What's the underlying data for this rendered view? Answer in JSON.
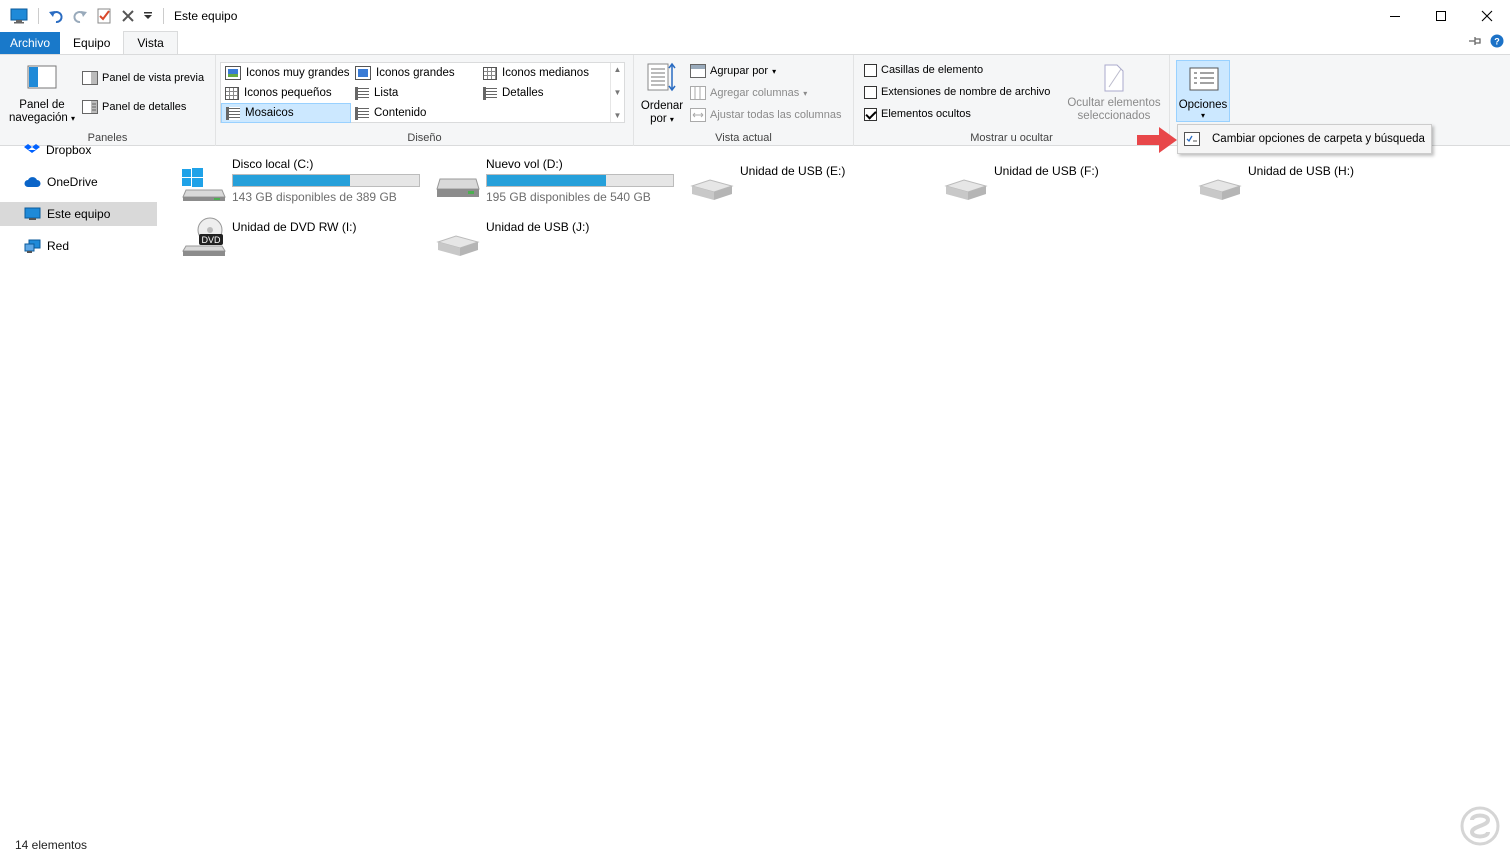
{
  "window": {
    "title": "Este equipo"
  },
  "tabs": {
    "file": "Archivo",
    "computer": "Equipo",
    "view": "Vista"
  },
  "ribbon": {
    "panes": {
      "nav_pane_line1": "Panel de",
      "nav_pane_line2": "navegación",
      "preview_pane": "Panel de vista previa",
      "details_pane": "Panel de detalles",
      "label": "Paneles"
    },
    "layout": {
      "extra_large": "Iconos muy grandes",
      "large": "Iconos grandes",
      "medium": "Iconos medianos",
      "small": "Iconos pequeños",
      "list": "Lista",
      "details": "Detalles",
      "tiles": "Mosaicos",
      "content": "Contenido",
      "label": "Diseño"
    },
    "current_view": {
      "sort_line1": "Ordenar",
      "sort_line2": "por",
      "group_by": "Agrupar por",
      "add_columns": "Agregar columnas",
      "size_columns": "Ajustar todas las columnas",
      "label": "Vista actual"
    },
    "show_hide": {
      "item_checkboxes": "Casillas de elemento",
      "file_extensions": "Extensiones de nombre de archivo",
      "hidden_items": "Elementos ocultos",
      "hide_selected_line1": "Ocultar elementos",
      "hide_selected_line2": "seleccionados",
      "label": "Mostrar u ocultar",
      "item_checkboxes_checked": false,
      "file_extensions_checked": false,
      "hidden_items_checked": true
    },
    "options": {
      "label": "Opciones"
    }
  },
  "menu": {
    "change_options": "Cambiar opciones de carpeta y búsqueda"
  },
  "nav": {
    "items": [
      {
        "label": "Dropbox",
        "icon": "dropbox-icon"
      },
      {
        "label": "OneDrive",
        "icon": "onedrive-icon"
      },
      {
        "label": "Este equipo",
        "icon": "computer-icon"
      },
      {
        "label": "Red",
        "icon": "network-icon"
      }
    ]
  },
  "drives": [
    {
      "name": "Disco local (C:)",
      "free": "143 GB disponibles de 389 GB",
      "used_fraction": 0.63,
      "icon": "windows-drive-icon"
    },
    {
      "name": "Nuevo vol (D:)",
      "free": "195 GB disponibles de 540 GB",
      "used_fraction": 0.64,
      "icon": "hard-drive-icon"
    },
    {
      "name": "Unidad de USB (E:)",
      "icon": "usb-drive-icon"
    },
    {
      "name": "Unidad de USB (F:)",
      "icon": "usb-drive-icon"
    },
    {
      "name": "Unidad de USB (H:)",
      "icon": "usb-drive-icon"
    },
    {
      "name": "Unidad de DVD RW (I:)",
      "icon": "dvd-drive-icon",
      "badge": "DVD"
    },
    {
      "name": "Unidad de USB (J:)",
      "icon": "usb-drive-icon"
    }
  ],
  "status": {
    "count": "14 elementos"
  },
  "colors": {
    "accent": "#1979ca",
    "bar_fill": "#26a0da",
    "selection": "#cce8ff",
    "arrow": "#e8474a"
  }
}
